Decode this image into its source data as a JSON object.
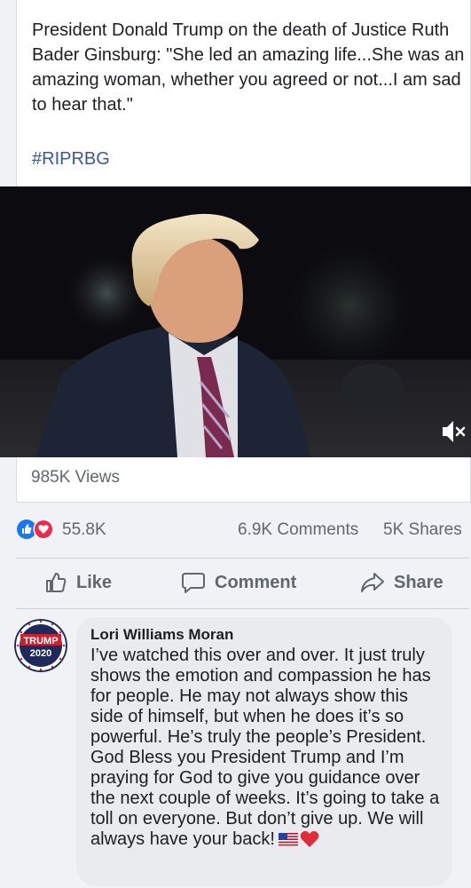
{
  "post": {
    "text": "President Donald Trump on the death of Justice Ruth Bader Ginsburg: \"She led an amazing life...She was an amazing woman, whether you agreed or not...I am sad to hear that.\"",
    "hashtag": "#RIPRBG",
    "link_color": "#385898"
  },
  "video": {
    "views": "985K Views",
    "mute_icon": "speaker-muted-icon"
  },
  "stats": {
    "reactions": "55.8K",
    "comments": "6.9K Comments",
    "shares": "5K Shares",
    "reaction_icons": [
      "like-reaction-icon",
      "love-reaction-icon"
    ]
  },
  "actions": {
    "like": "Like",
    "comment": "Comment",
    "share": "Share"
  },
  "comment": {
    "avatar_text_1": "TRUMP",
    "avatar_text_2": "2020",
    "author": "Lori Williams Moran",
    "text": "I’ve watched this over and over. It just truly shows the emotion and compassion he has for people. He may not always show this side of himself, but when he does it’s so powerful. He’s truly the people’s President. God Bless you President Trump and I’m praying for God to give you guidance over the next couple of weeks. It’s going to take a toll on everyone. But don’t give up. We will always have your back!",
    "emojis": [
      "us-flag-icon",
      "red-heart-icon"
    ]
  }
}
